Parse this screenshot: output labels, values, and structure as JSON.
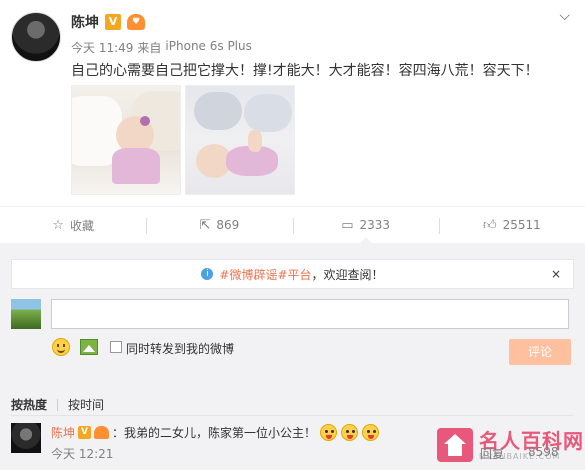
{
  "post": {
    "author": "陈坤",
    "verified_badge": "V",
    "fan_badge_icon": "fan-badge-icon",
    "time": "今天 11:49",
    "source_prefix": "来自",
    "source": "iPhone 6s Plus",
    "text": "自己的心需要自己把它撑大！撑!才能大！大才能容！容四海八荒！容天下！",
    "photos": [
      "baby-photo-1",
      "baby-photo-2"
    ]
  },
  "actions": {
    "favorite": {
      "icon": "star-icon",
      "label": "收藏"
    },
    "repost": {
      "icon": "share-icon",
      "count": "869"
    },
    "comment": {
      "icon": "comment-icon",
      "count": "2333"
    },
    "like": {
      "icon": "thumbs-up-icon",
      "count": "25511"
    }
  },
  "notice": {
    "text_link": "#微博辟谣#平台",
    "text_rest": "，欢迎查阅！",
    "close": "×"
  },
  "composer": {
    "input_value": "",
    "forward_label": "同时转发到我的微博",
    "submit_label": "评论"
  },
  "sort": {
    "hot": "按热度",
    "time": "按时间"
  },
  "comments": [
    {
      "author": "陈坤",
      "text": "：我弟的二女儿，陈家第一位小公主！",
      "time": "今天 12:21",
      "reply_label": "回复",
      "likes": "8598"
    }
  ],
  "watermark": {
    "title": "名人百科网",
    "url": "MRENBAIKE.COM"
  },
  "colors": {
    "accent": "#eb7350",
    "panel_bg": "#f2f2f5",
    "submit_disabled": "#ffc09f",
    "verified": "#f5a623"
  }
}
